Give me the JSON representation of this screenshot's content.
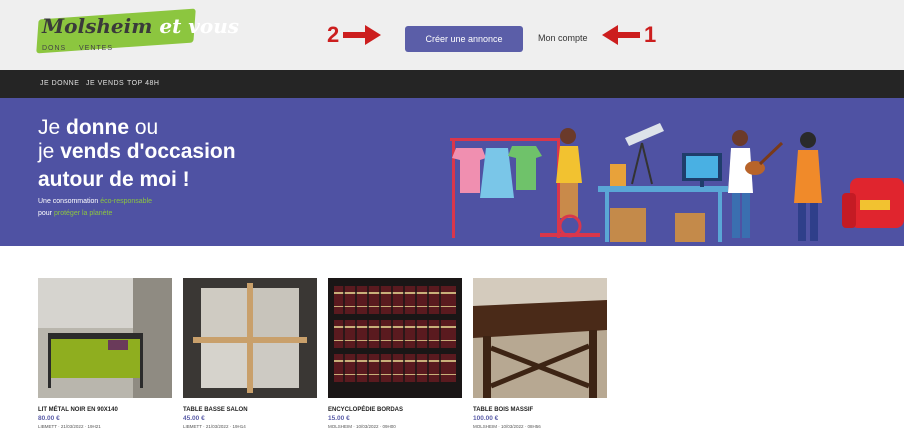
{
  "header": {
    "logo_title": "Molsheim",
    "logo_title_accent": " et vous",
    "logo_sub_a": "DONS",
    "logo_sub_b": "VENTES",
    "create_button": "Créer une annonce",
    "account_link": "Mon compte"
  },
  "annotations": {
    "num_create": "2",
    "num_account": "1"
  },
  "nav": {
    "items": [
      "JE DONNE",
      "JE VENDS",
      "TOP 48H"
    ]
  },
  "hero": {
    "line1_a": "Je ",
    "line1_bold": "donne",
    "line1_b": " ou",
    "line2_a": "je ",
    "line2_bold": "vends d'occasion",
    "line3": "autour de moi !",
    "tag1_a": "Une consommation ",
    "tag1_green": "éco-responsable",
    "tag2_a": "pour ",
    "tag2_green": "protéger la planète"
  },
  "products": [
    {
      "name": "LIT MÉTAL NOIR EN 90X140",
      "price": "80.00 €",
      "meta": "LIBMETT · 21/03/2022 · 19H21"
    },
    {
      "name": "TABLE BASSE SALON",
      "price": "45.00 €",
      "meta": "LIBMETT · 21/03/2022 · 19H14"
    },
    {
      "name": "ENCYCLOPÉDIE BORDAS",
      "price": "15.00 €",
      "meta": "MOLSHEIM · 10/03/2022 · 09H00"
    },
    {
      "name": "TABLE BOIS MASSIF",
      "price": "100.00 €",
      "meta": "MOLSHEIM · 10/03/2022 · 08H56"
    }
  ],
  "colors": {
    "brand_green": "#8cc63f",
    "brand_purple": "#5b5ea8",
    "hero_bg": "#4f52a3",
    "nav_bg": "#252525",
    "annotation_red": "#cc1e1e"
  }
}
